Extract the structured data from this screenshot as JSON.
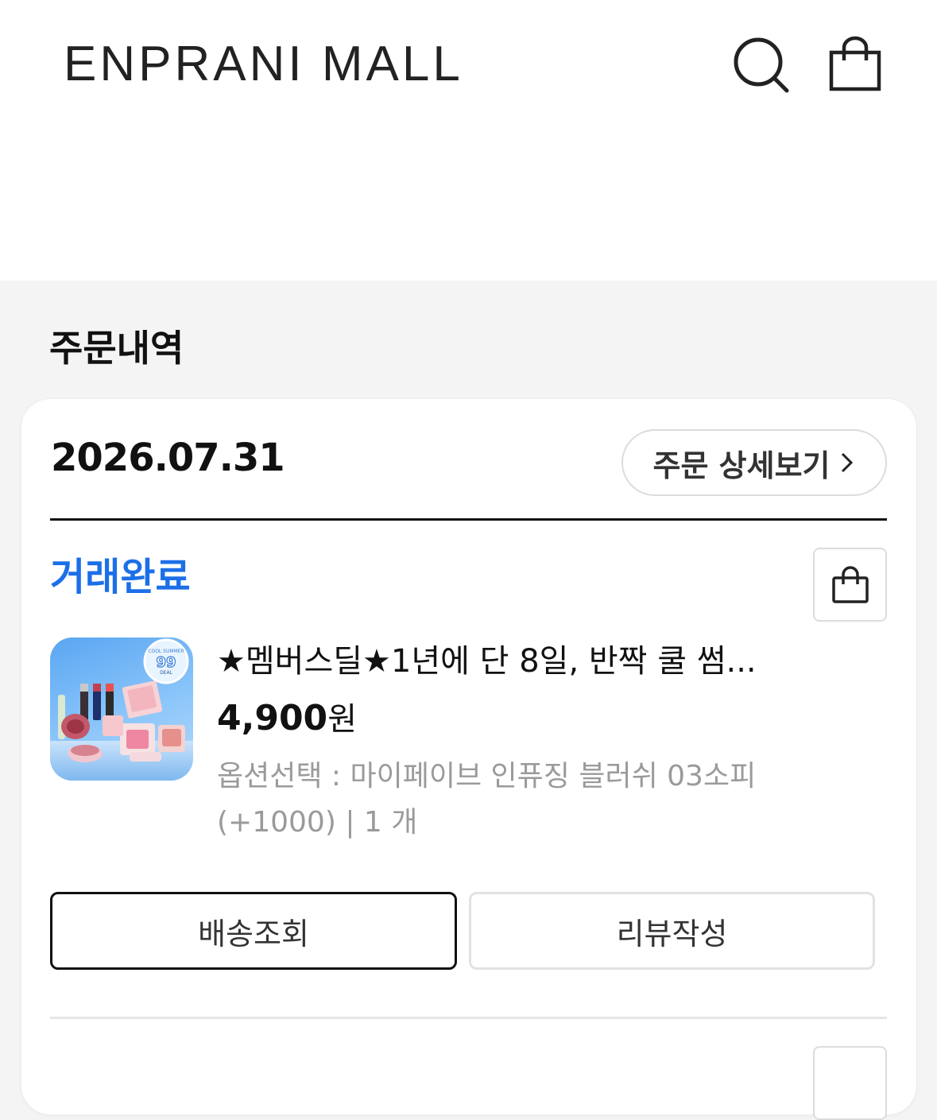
{
  "header": {
    "logo": "ENPRANI MALL",
    "search_icon": "search-icon",
    "cart_icon": "shopping-bag-icon"
  },
  "page": {
    "title": "주문내역"
  },
  "order": {
    "date": "2026.07.31",
    "detail_label": "주문 상세보기",
    "status": "거래완료",
    "status_color": "#1d6fe8",
    "product": {
      "name": "★멤버스딜★1년에 단 8일, 반짝 쿨 썸...",
      "price": "4,900",
      "price_unit": "원",
      "option": "옵션선택 : 마이페이브 인퓨징 블러쉬 03소피(+1000) | 1 개",
      "thumbnail": {
        "badge_top": "COOL SUMMER",
        "badge_number": "99",
        "badge_bottom": "DEAL"
      }
    },
    "buttons": {
      "track": "배송조회",
      "review": "리뷰작성"
    }
  }
}
